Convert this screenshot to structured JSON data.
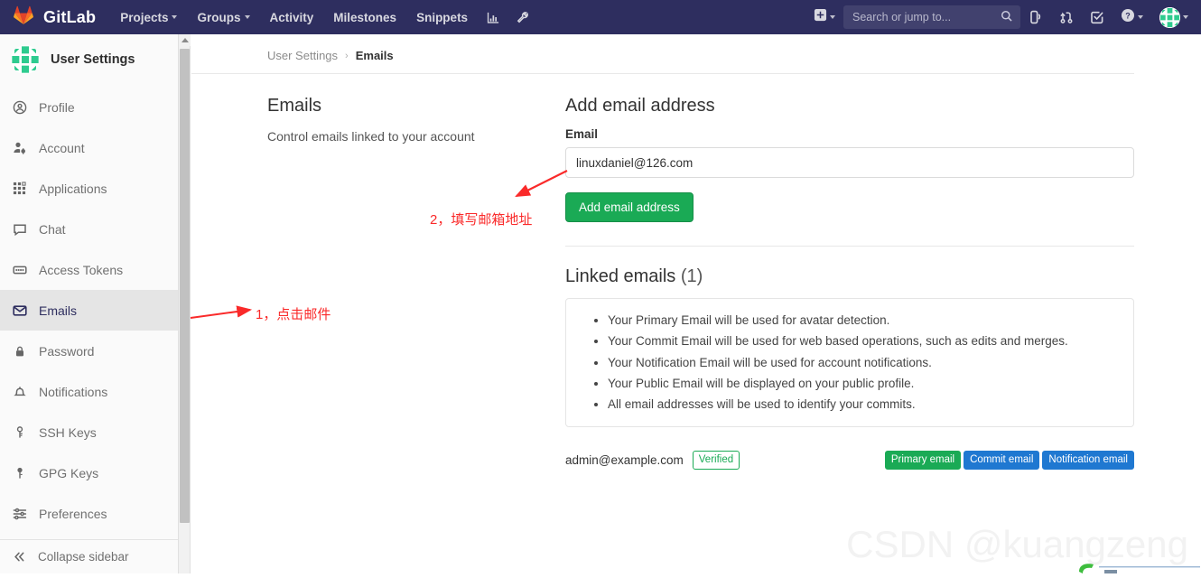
{
  "navbar": {
    "brand": "GitLab",
    "logo_icon": "gitlab-fox-logo",
    "items": [
      {
        "label": "Projects",
        "has_caret": true
      },
      {
        "label": "Groups",
        "has_caret": true
      },
      {
        "label": "Activity",
        "has_caret": false
      },
      {
        "label": "Milestones",
        "has_caret": false
      },
      {
        "label": "Snippets",
        "has_caret": false
      }
    ],
    "icon_links": [
      {
        "name": "analytics-chart-icon"
      },
      {
        "name": "wrench-admin-icon"
      }
    ],
    "right_icons": [
      {
        "name": "plus-new-icon",
        "has_caret": true
      },
      {
        "name": "issues-icon",
        "has_caret": false
      },
      {
        "name": "merge-requests-icon",
        "has_caret": false
      },
      {
        "name": "todos-checkbox-icon",
        "has_caret": false
      },
      {
        "name": "help-question-icon",
        "has_caret": true
      },
      {
        "name": "user-avatar-icon",
        "has_caret": true
      }
    ],
    "search": {
      "placeholder": "Search or jump to...",
      "value": "",
      "icon": "search-icon"
    },
    "colors": {
      "background": "#2e2e5f",
      "search_background": "#41416e"
    }
  },
  "sidebar": {
    "header_title": "User Settings",
    "avatar_icon": "identicon-avatar",
    "items": [
      {
        "label": "Profile",
        "icon": "user-circle-icon",
        "active": false
      },
      {
        "label": "Account",
        "icon": "account-gear-icon",
        "active": false
      },
      {
        "label": "Applications",
        "icon": "applications-grid-icon",
        "active": false
      },
      {
        "label": "Chat",
        "icon": "chat-bubble-icon",
        "active": false
      },
      {
        "label": "Access Tokens",
        "icon": "token-card-icon",
        "active": false
      },
      {
        "label": "Emails",
        "icon": "envelope-icon",
        "active": true
      },
      {
        "label": "Password",
        "icon": "lock-icon",
        "active": false
      },
      {
        "label": "Notifications",
        "icon": "bell-icon",
        "active": false
      },
      {
        "label": "SSH Keys",
        "icon": "key-icon",
        "active": false
      },
      {
        "label": "GPG Keys",
        "icon": "gpg-key-icon",
        "active": false
      },
      {
        "label": "Preferences",
        "icon": "sliders-icon",
        "active": false
      }
    ],
    "collapse_label": "Collapse sidebar",
    "collapse_icon": "double-chevron-left-icon",
    "active_background": "#e5e5e5",
    "active_color": "#2e2e5f"
  },
  "breadcrumb": {
    "parent": "User Settings",
    "separator": "›",
    "current": "Emails"
  },
  "left_panel": {
    "title": "Emails",
    "subtitle": "Control emails linked to your account"
  },
  "add_email": {
    "title": "Add email address",
    "field_label": "Email",
    "input_value": "linuxdaniel@126.com",
    "input_placeholder": "",
    "submit_label": "Add email address",
    "submit_color": "#1aaa55"
  },
  "linked_emails": {
    "title": "Linked emails",
    "count_text": "(1)",
    "notes": [
      "Your Primary Email will be used for avatar detection.",
      "Your Commit Email will be used for web based operations, such as edits and merges.",
      "Your Notification Email will be used for account notifications.",
      "Your Public Email will be displayed on your public profile.",
      "All email addresses will be used to identify your commits."
    ],
    "rows": [
      {
        "address": "admin@example.com",
        "verified_badge": "Verified",
        "badges": [
          {
            "label": "Primary email",
            "color": "#1aaa55"
          },
          {
            "label": "Commit email",
            "color": "#1f78d1"
          },
          {
            "label": "Notification email",
            "color": "#1f78d1"
          }
        ]
      }
    ]
  },
  "annotations": [
    {
      "text": "1，点击邮件",
      "color": "#fa2a2a"
    },
    {
      "text": "2，填写邮箱地址",
      "color": "#fa2a2a"
    }
  ],
  "watermark": {
    "text": "CSDN @kuangzeng"
  }
}
